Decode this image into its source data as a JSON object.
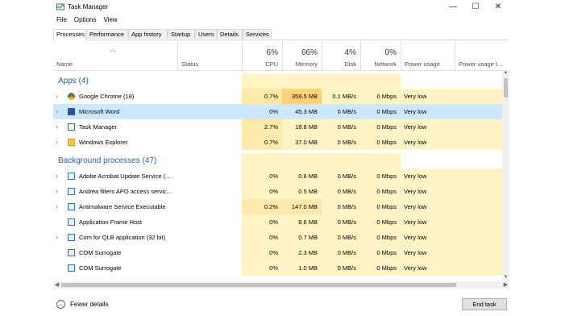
{
  "window": {
    "title": "Task Manager",
    "minimize_glyph": "—",
    "maximize_glyph": "☐",
    "close_glyph": "✕"
  },
  "menu": [
    "File",
    "Options",
    "View"
  ],
  "tabs": [
    "Processes",
    "Performance",
    "App history",
    "Startup",
    "Users",
    "Details",
    "Services"
  ],
  "columns": {
    "name": "Name",
    "status": "Status",
    "cpu": {
      "pct": "6%",
      "label": "CPU"
    },
    "memory": {
      "pct": "66%",
      "label": "Memory"
    },
    "disk": {
      "pct": "4%",
      "label": "Disk"
    },
    "network": {
      "pct": "0%",
      "label": "Network"
    },
    "power": "Power usage",
    "power_trend": "Power usage t..."
  },
  "sections": {
    "apps": "Apps (4)",
    "background": "Background processes (47)"
  },
  "apps": [
    {
      "name": "Google Chrome (18)",
      "cpu": "0.7%",
      "memory": "359.5 MB",
      "disk": "0.1 MB/s",
      "network": "0 Mbps",
      "power": "Very low",
      "icon": "chrome-icon",
      "expandable": true
    },
    {
      "name": "Microsoft Word",
      "cpu": "0%",
      "memory": "45.3 MB",
      "disk": "0 MB/s",
      "network": "0 Mbps",
      "power": "Very low",
      "icon": "word-icon",
      "expandable": true,
      "selected": true
    },
    {
      "name": "Task Manager",
      "cpu": "2.7%",
      "memory": "18.8 MB",
      "disk": "0 MB/s",
      "network": "0 Mbps",
      "power": "Very low",
      "icon": "taskmgr-icon",
      "expandable": true
    },
    {
      "name": "Windows Explorer",
      "cpu": "0.7%",
      "memory": "37.0 MB",
      "disk": "0 MB/s",
      "network": "0 Mbps",
      "power": "Very low",
      "icon": "explorer-icon",
      "expandable": true
    }
  ],
  "background": [
    {
      "name": "Adobe Acrobat Update Service (...",
      "cpu": "0%",
      "memory": "0.6 MB",
      "disk": "0 MB/s",
      "network": "0 Mbps",
      "power": "Very low",
      "expandable": true
    },
    {
      "name": "Andrea filters APO access servic...",
      "cpu": "0%",
      "memory": "0.5 MB",
      "disk": "0 MB/s",
      "network": "0 Mbps",
      "power": "Very low",
      "expandable": true
    },
    {
      "name": "Antimalware Service Executable",
      "cpu": "0.2%",
      "memory": "147.0 MB",
      "disk": "0 MB/s",
      "network": "0 Mbps",
      "power": "Very low",
      "expandable": true
    },
    {
      "name": "Application Frame Host",
      "cpu": "0%",
      "memory": "8.6 MB",
      "disk": "0 MB/s",
      "network": "0 Mbps",
      "power": "Very low",
      "expandable": false
    },
    {
      "name": "Com for QLB application (32 bit)",
      "cpu": "0%",
      "memory": "0.7 MB",
      "disk": "0 MB/s",
      "network": "0 Mbps",
      "power": "Very low",
      "expandable": true
    },
    {
      "name": "COM Surrogate",
      "cpu": "0%",
      "memory": "2.3 MB",
      "disk": "0 MB/s",
      "network": "0 Mbps",
      "power": "Very low",
      "expandable": false
    },
    {
      "name": "COM Surrogate",
      "cpu": "0%",
      "memory": "1.0 MB",
      "disk": "0 MB/s",
      "network": "0 Mbps",
      "power": "Very low",
      "expandable": false
    }
  ],
  "footer": {
    "fewer_details": "Fewer details",
    "end_task": "End task"
  },
  "colors": {
    "heat_light": "#fff4c4",
    "heat_mid": "#ffe9a8",
    "heat_strong": "#ffd27a",
    "selected": "#cce8ff",
    "section_blue": "#1f5fc4"
  }
}
